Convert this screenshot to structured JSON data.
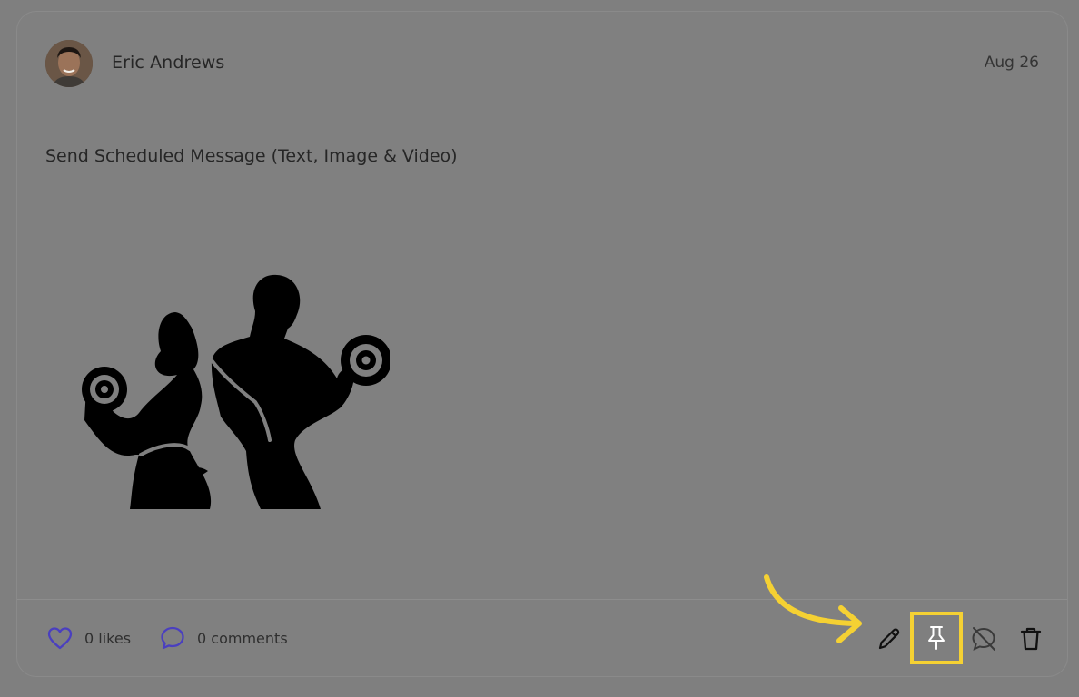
{
  "post": {
    "author": "Eric Andrews",
    "date": "Aug 26",
    "text": "Send Scheduled Message (Text, Image & Video)"
  },
  "footer": {
    "likes": "0 likes",
    "comments": "0 comments"
  },
  "icons": {
    "like": "heart-icon",
    "comment": "chat-bubble-icon",
    "edit": "pencil-icon",
    "pin": "pin-icon",
    "disable_comments": "comment-off-icon",
    "delete": "trash-icon"
  },
  "colors": {
    "overlay": "#7f7f7f",
    "accent": "#4a3fbf",
    "highlight": "#f5d133",
    "text": "#262626"
  }
}
